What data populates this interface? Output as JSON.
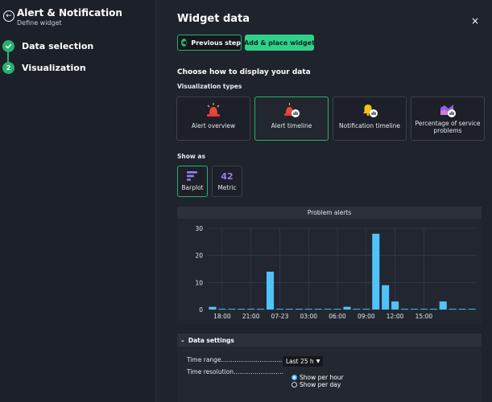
{
  "sidebar": {
    "title": "Alert & Notification",
    "subtitle": "Define widget",
    "steps": [
      {
        "label": "Data selection",
        "number": "",
        "state": "done"
      },
      {
        "label": "Visualization",
        "number": "2",
        "state": "active"
      }
    ]
  },
  "main": {
    "title": "Widget data",
    "close": "×",
    "prev_label": "Previous step",
    "add_label": "Add & place widget",
    "choose_heading": "Choose how to display your data",
    "viz_heading": "Visualization types",
    "viz_types": [
      {
        "label": "Alert overview",
        "icon": "alarm-siren-icon",
        "selected": false
      },
      {
        "label": "Alert timeline",
        "icon": "alarm-timeline-icon",
        "selected": true
      },
      {
        "label": "Notification timeline",
        "icon": "bell-timeline-icon",
        "selected": false
      },
      {
        "label": "Percentage of service problems",
        "icon": "service-problems-icon",
        "selected": false
      }
    ],
    "show_heading": "Show as",
    "show_as": [
      {
        "label": "Barplot",
        "icon": "barplot-icon",
        "selected": true
      },
      {
        "label": "Metric",
        "value": "42",
        "selected": false
      }
    ]
  },
  "chart_data": {
    "type": "bar",
    "title": "Problem alerts",
    "xlabel": "",
    "ylabel": "",
    "ylim": [
      0,
      30
    ],
    "yticks": [
      "0",
      "10",
      "20",
      "30"
    ],
    "xticks": [
      "18:00",
      "21:00",
      "07-23",
      "03:00",
      "06:00",
      "09:00",
      "12:00",
      "15:00"
    ],
    "values": [
      1,
      0,
      0,
      0,
      0,
      0,
      14,
      0,
      0,
      0,
      0,
      0,
      0,
      0,
      1,
      0,
      0,
      28,
      9,
      3,
      0,
      0,
      0,
      0,
      3,
      0,
      0,
      0
    ],
    "bar_color": "#4fc3f7",
    "grid": true
  },
  "settings": {
    "heading": "Data settings",
    "time_range_label": "Time range.................................",
    "time_range_value": "Last 25 h",
    "time_resolution_label": "Time resolution..........................",
    "resolution_options": [
      {
        "label": "Show per hour",
        "checked": true
      },
      {
        "label": "Show per day",
        "checked": false
      }
    ]
  },
  "colors": {
    "accent": "#2ab06f",
    "accent_bright": "#2fd08b",
    "bar": "#4fc3f7",
    "metric": "#9b7cf2"
  }
}
